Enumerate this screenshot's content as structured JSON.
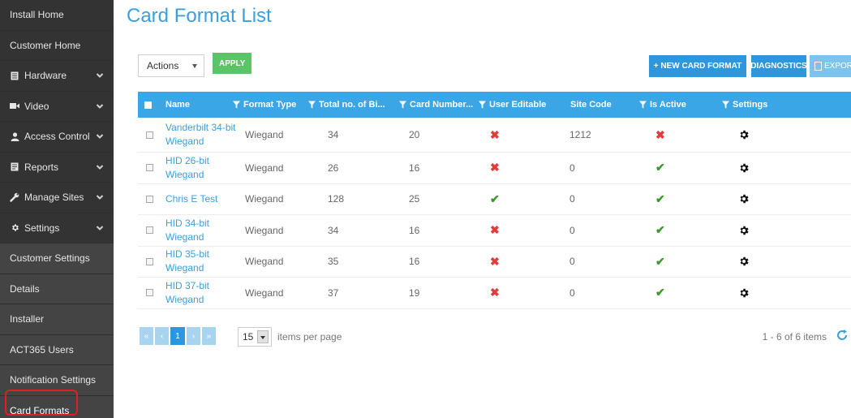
{
  "sidebar": {
    "items": [
      {
        "label": "Install Home",
        "icon": null,
        "chevron": false
      },
      {
        "label": "Customer Home",
        "icon": null,
        "chevron": false
      },
      {
        "label": "Hardware",
        "icon": "hardware-icon",
        "chevron": true
      },
      {
        "label": "Video",
        "icon": "video-icon",
        "chevron": true
      },
      {
        "label": "Access Control",
        "icon": "user-icon",
        "chevron": true
      },
      {
        "label": "Reports",
        "icon": "report-icon",
        "chevron": true
      },
      {
        "label": "Manage Sites",
        "icon": "wrench-icon",
        "chevron": true
      },
      {
        "label": "Settings",
        "icon": "gear-icon",
        "chevron": true
      }
    ],
    "sub_items": [
      {
        "label": "Customer Settings"
      },
      {
        "label": "Details"
      },
      {
        "label": "Installer"
      },
      {
        "label": "ACT365 Users"
      },
      {
        "label": "Notification Settings"
      },
      {
        "label": "Card Formats"
      }
    ]
  },
  "main": {
    "title": "Card Format List",
    "toolbar": {
      "actions_value": "Actions",
      "apply_label": "APPLY",
      "new_label": "+ NEW CARD FORMAT",
      "diagnostics_label": "DIAGNOSTICS",
      "export_label": "EXPORT"
    },
    "table": {
      "headers": [
        "Name",
        "Format Type",
        "Total no. of Bi...",
        "Card Number...",
        "User Editable",
        "Site Code",
        "Is Active",
        "Settings"
      ],
      "rows": [
        {
          "name": "Vanderbilt 34-bit Wiegand",
          "format": "Wiegand",
          "bits": "34",
          "card_number": "20",
          "user_editable": false,
          "site_code": "1212",
          "is_active": false
        },
        {
          "name": "HID 26-bit Wiegand",
          "format": "Wiegand",
          "bits": "26",
          "card_number": "16",
          "user_editable": false,
          "site_code": "0",
          "is_active": true
        },
        {
          "name": "Chris E Test",
          "format": "Wiegand",
          "bits": "128",
          "card_number": "25",
          "user_editable": true,
          "site_code": "0",
          "is_active": true
        },
        {
          "name": "HID 34-bit Wiegand",
          "format": "Wiegand",
          "bits": "34",
          "card_number": "16",
          "user_editable": false,
          "site_code": "0",
          "is_active": true
        },
        {
          "name": "HID 35-bit Wiegand",
          "format": "Wiegand",
          "bits": "35",
          "card_number": "16",
          "user_editable": false,
          "site_code": "0",
          "is_active": true
        },
        {
          "name": "HID 37-bit Wiegand",
          "format": "Wiegand",
          "bits": "37",
          "card_number": "19",
          "user_editable": false,
          "site_code": "0",
          "is_active": true
        }
      ]
    },
    "pager": {
      "first": "«",
      "prev": "‹",
      "current_page": "1",
      "next": "›",
      "last": "»",
      "page_size": "15",
      "per_page_label": "items per page",
      "items_info": "1 - 6 of 6 items"
    }
  },
  "colors": {
    "accent": "#3aa6e6",
    "sidebar_bg": "#3a3a3a",
    "apply_green": "#5cc466",
    "check_green": "#3a9a2a",
    "cross_red": "#e23b3b",
    "highlight_ring": "#e02020"
  }
}
